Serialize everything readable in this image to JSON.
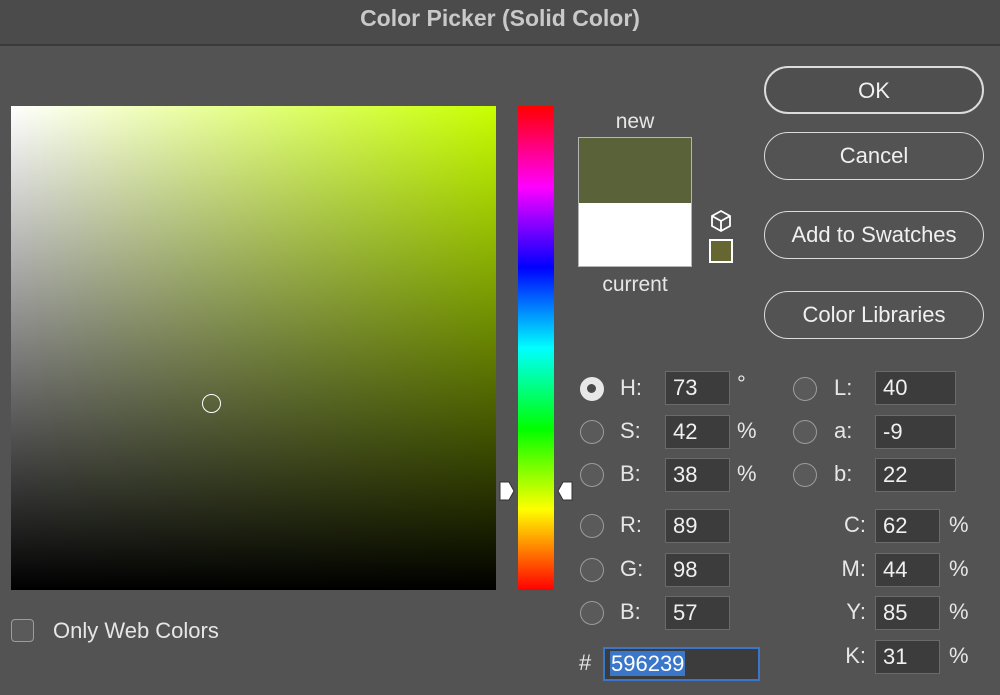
{
  "window": {
    "title": "Color Picker (Solid Color)"
  },
  "colors": {
    "new": "#596239",
    "current": "#ffffff",
    "field_hue": "#c8ff00",
    "websafe": "#666633"
  },
  "swatches": {
    "new_label": "new",
    "current_label": "current"
  },
  "buttons": {
    "ok": "OK",
    "cancel": "Cancel",
    "add_to_swatches": "Add to Swatches",
    "color_libraries": "Color Libraries"
  },
  "hsb": {
    "h": {
      "label": "H:",
      "value": "73",
      "unit": "°"
    },
    "s": {
      "label": "S:",
      "value": "42",
      "unit": "%"
    },
    "b": {
      "label": "B:",
      "value": "38",
      "unit": "%"
    },
    "selected": "h"
  },
  "rgb": {
    "r": {
      "label": "R:",
      "value": "89"
    },
    "g": {
      "label": "G:",
      "value": "98"
    },
    "b": {
      "label": "B:",
      "value": "57"
    }
  },
  "lab": {
    "l": {
      "label": "L:",
      "value": "40"
    },
    "a": {
      "label": "a:",
      "value": "-9"
    },
    "b": {
      "label": "b:",
      "value": "22"
    }
  },
  "cmyk": {
    "c": {
      "label": "C:",
      "value": "62",
      "unit": "%"
    },
    "m": {
      "label": "M:",
      "value": "44",
      "unit": "%"
    },
    "y": {
      "label": "Y:",
      "value": "85",
      "unit": "%"
    },
    "k": {
      "label": "K:",
      "value": "31",
      "unit": "%"
    }
  },
  "hex": {
    "prefix": "#",
    "value": "596239"
  },
  "options": {
    "only_web_colors": {
      "label": "Only Web Colors",
      "checked": false
    }
  },
  "icons": {
    "websafe_warning": "cube-icon",
    "slider_arrows": "triangle-arrow-icon"
  }
}
